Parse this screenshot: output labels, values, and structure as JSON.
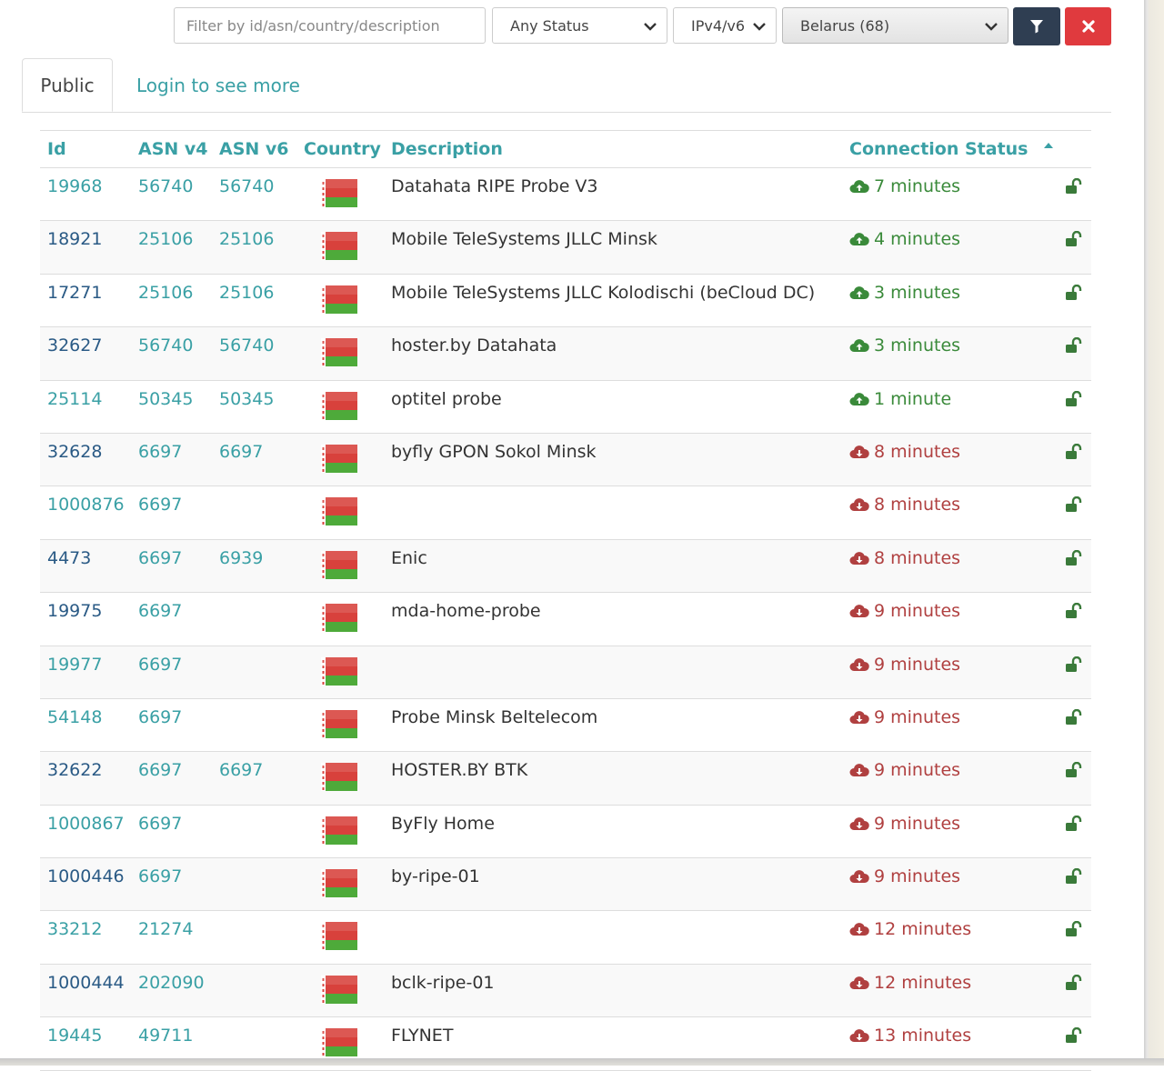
{
  "filters": {
    "search_placeholder": "Filter by id/asn/country/description",
    "status_selected": "Any Status",
    "ip_selected": "IPv4/v6",
    "country_selected": "Belarus (68)"
  },
  "tabs": {
    "public_label": "Public",
    "login_label": "Login to see more"
  },
  "table": {
    "headers": {
      "id": "Id",
      "asn_v4": "ASN v4",
      "asn_v6": "ASN v6",
      "country": "Country",
      "description": "Description",
      "status": "Connection Status"
    },
    "rows": [
      {
        "id": "19968",
        "id_color": "teal",
        "asn_v4": "56740",
        "asn_v6": "56740",
        "description": "Datahata RIPE Probe V3",
        "status": "7 minutes",
        "connected": true
      },
      {
        "id": "18921",
        "id_color": "navy",
        "asn_v4": "25106",
        "asn_v6": "25106",
        "description": "Mobile TeleSystems JLLC Minsk",
        "status": "4 minutes",
        "connected": true
      },
      {
        "id": "17271",
        "id_color": "navy",
        "asn_v4": "25106",
        "asn_v6": "25106",
        "description": "Mobile TeleSystems JLLC Kolodischi (beCloud DC)",
        "status": "3 minutes",
        "connected": true
      },
      {
        "id": "32627",
        "id_color": "navy",
        "asn_v4": "56740",
        "asn_v6": "56740",
        "description": "hoster.by Datahata",
        "status": "3 minutes",
        "connected": true
      },
      {
        "id": "25114",
        "id_color": "teal",
        "asn_v4": "50345",
        "asn_v6": "50345",
        "description": "optitel probe",
        "status": "1 minute",
        "connected": true
      },
      {
        "id": "32628",
        "id_color": "navy",
        "asn_v4": "6697",
        "asn_v6": "6697",
        "description": "byfly GPON Sokol Minsk",
        "status": "8 minutes",
        "connected": false
      },
      {
        "id": "1000876",
        "id_color": "teal",
        "asn_v4": "6697",
        "asn_v6": "",
        "description": "",
        "status": "8 minutes",
        "connected": false
      },
      {
        "id": "4473",
        "id_color": "navy",
        "asn_v4": "6697",
        "asn_v6": "6939",
        "description": "Enic",
        "status": "8 minutes",
        "connected": false
      },
      {
        "id": "19975",
        "id_color": "navy",
        "asn_v4": "6697",
        "asn_v6": "",
        "description": "mda-home-probe",
        "status": "9 minutes",
        "connected": false
      },
      {
        "id": "19977",
        "id_color": "teal",
        "asn_v4": "6697",
        "asn_v6": "",
        "description": "",
        "status": "9 minutes",
        "connected": false
      },
      {
        "id": "54148",
        "id_color": "teal",
        "asn_v4": "6697",
        "asn_v6": "",
        "description": "Probe Minsk Beltelecom",
        "status": "9 minutes",
        "connected": false
      },
      {
        "id": "32622",
        "id_color": "navy",
        "asn_v4": "6697",
        "asn_v6": "6697",
        "description": "HOSTER.BY BTK",
        "status": "9 minutes",
        "connected": false
      },
      {
        "id": "1000867",
        "id_color": "teal",
        "asn_v4": "6697",
        "asn_v6": "",
        "description": "ByFly Home",
        "status": "9 minutes",
        "connected": false
      },
      {
        "id": "1000446",
        "id_color": "navy",
        "asn_v4": "6697",
        "asn_v6": "",
        "description": "by-ripe-01",
        "status": "9 minutes",
        "connected": false
      },
      {
        "id": "33212",
        "id_color": "teal",
        "asn_v4": "21274",
        "asn_v6": "",
        "description": "",
        "status": "12 minutes",
        "connected": false
      },
      {
        "id": "1000444",
        "id_color": "navy",
        "asn_v4": "202090",
        "asn_v6": "",
        "description": "bclk-ripe-01",
        "status": "12 minutes",
        "connected": false
      },
      {
        "id": "19445",
        "id_color": "teal",
        "asn_v4": "49711",
        "asn_v6": "",
        "description": "FLYNET",
        "status": "13 minutes",
        "connected": false
      }
    ]
  },
  "icons": {
    "filter_button": "filter-icon",
    "clear_button": "close-icon",
    "sort": "sort-up-icon",
    "cloud_up": "cloud-upload-icon",
    "cloud_down": "cloud-download-icon",
    "lock": "unlock-icon",
    "flag": "belarus-flag-icon"
  },
  "colors": {
    "accent_teal": "#3aa0a5",
    "id_navy": "#2a5a85",
    "connected_green": "#3a8a3a",
    "disconnected_red": "#b04040",
    "filter_button_bg": "#2f3e52",
    "clear_button_bg": "#e03a3e",
    "flag_red": "#d8413c",
    "flag_green": "#4eaa3a"
  }
}
